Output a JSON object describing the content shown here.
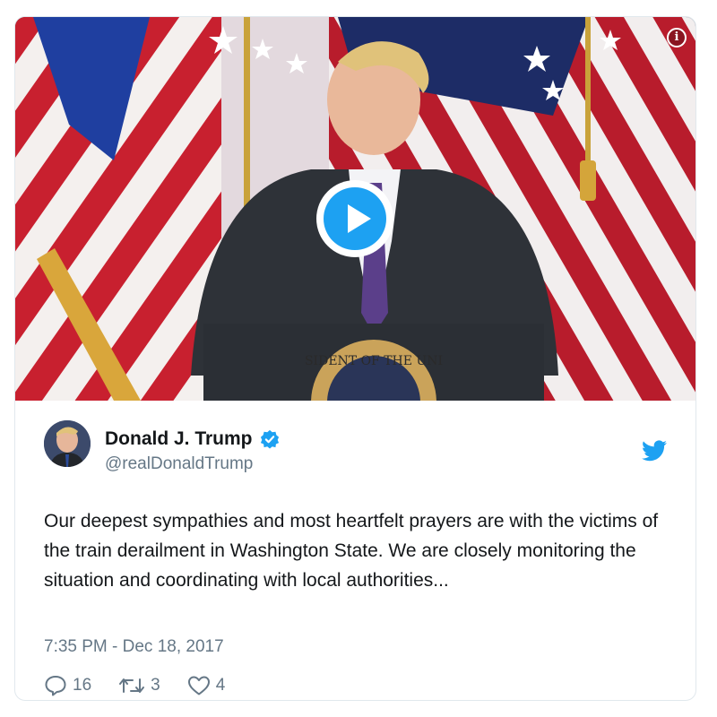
{
  "media": {
    "info_icon": "info-icon",
    "play_icon": "play-icon",
    "seal_text": "SIDENT OF THE UNI",
    "accent_color": "#1da1f2"
  },
  "tweet": {
    "display_name": "Donald J. Trump",
    "handle": "@realDonaldTrump",
    "verified_icon": "verified-badge-icon",
    "logo_icon": "twitter-bird-icon",
    "text": "Our deepest sympathies and most heartfelt prayers are with the victims of the train derailment in Washington State. We are closely monitoring the situation and coordinating with local authorities...",
    "timestamp": "7:35 PM - Dec 18, 2017",
    "replies": "16",
    "retweets": "3",
    "likes": "4"
  },
  "colors": {
    "name": "#14171a",
    "secondary": "#657786",
    "brand": "#1da1f2"
  }
}
